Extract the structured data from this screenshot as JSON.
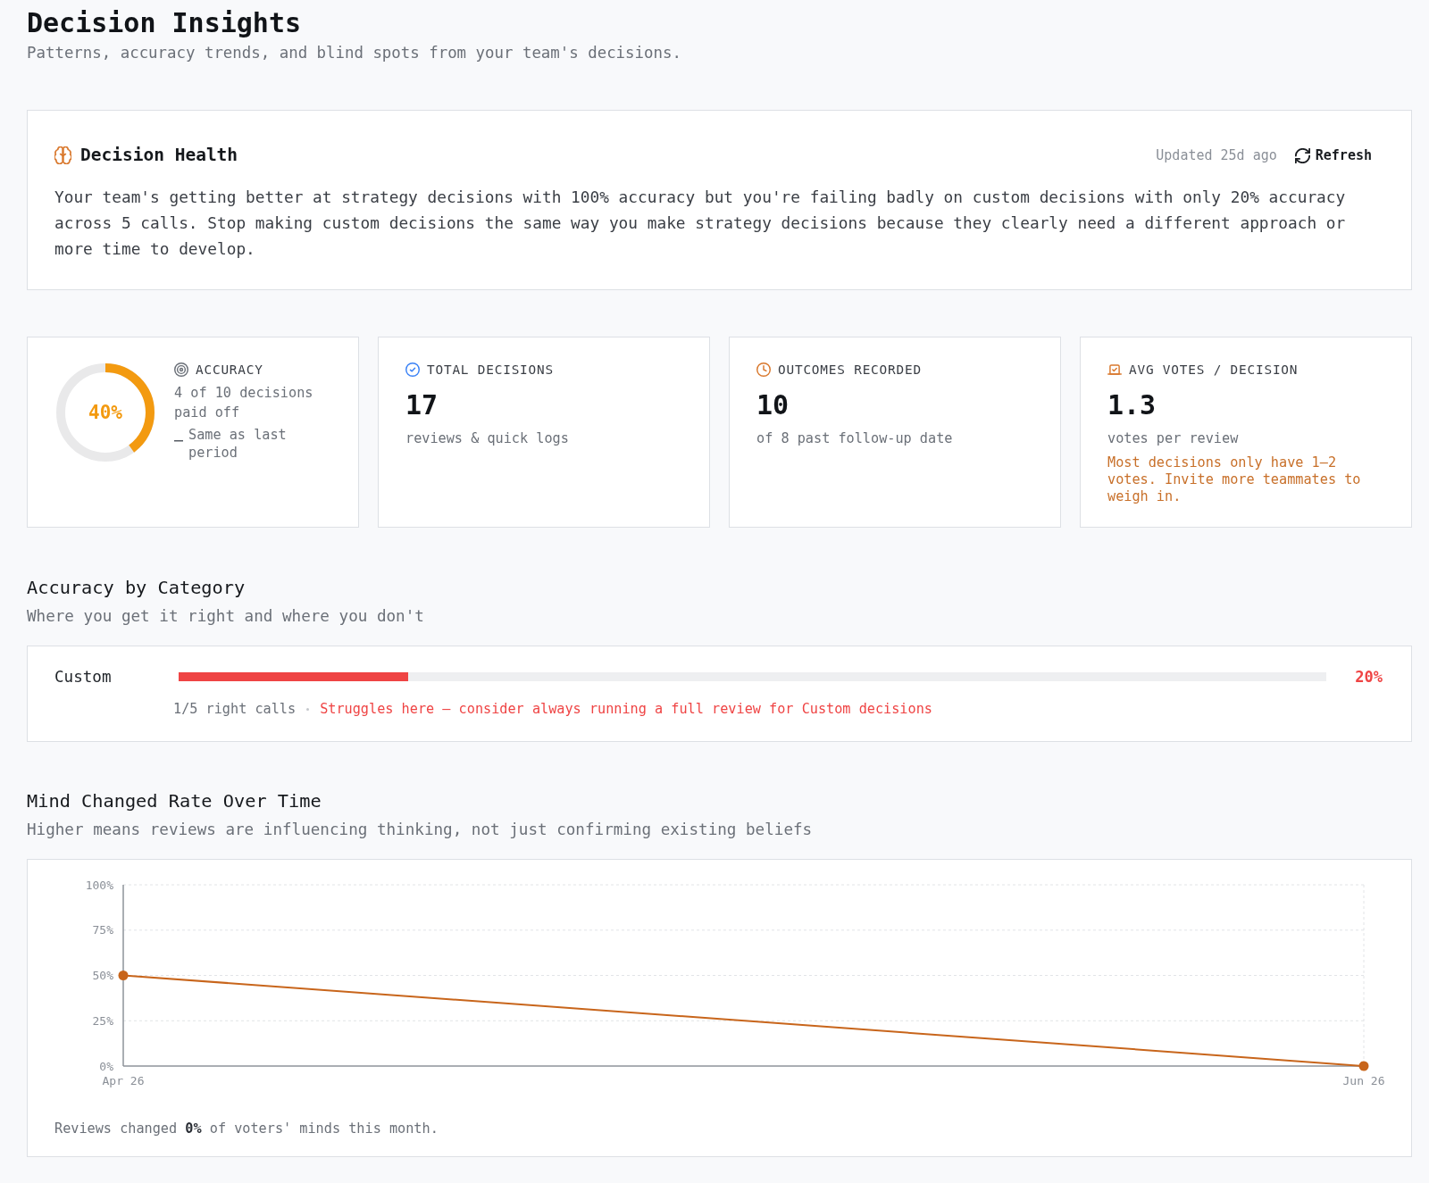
{
  "header": {
    "title": "Decision Insights",
    "subtitle": "Patterns, accuracy trends, and blind spots from your team's decisions."
  },
  "decision_health": {
    "title": "Decision Health",
    "updated": "Updated 25d ago",
    "refresh_button": "Refresh",
    "summary": "Your team's getting better at strategy decisions with 100% accuracy but you're failing badly on custom decisions with only 20% accuracy across 5 calls. Stop making custom decisions the same way you make strategy decisions because they clearly need a different approach or more time to develop."
  },
  "stats": [
    {
      "kind": "donut",
      "label": "ACCURACY",
      "level": 0.4,
      "value": "40%",
      "detail": "4 of 10 decisions paid off",
      "trend": "Same as last period"
    },
    {
      "kind": "metric",
      "label": "TOTAL DECISIONS",
      "value": "17",
      "detail": "reviews & quick logs"
    },
    {
      "kind": "metric",
      "label": "OUTCOMES RECORDED",
      "value": "10",
      "detail": "of 8 past follow-up date"
    },
    {
      "kind": "metric",
      "label": "AVG VOTES / DECISION",
      "value": "1.3",
      "detail": "votes per review",
      "note": "Most decisions only have 1–2 votes. Invite more teammates to weigh in."
    }
  ],
  "accuracy_by_category": {
    "title": "Accuracy by Category",
    "subtitle": "Where you get it right and where you don't",
    "rows": [
      {
        "name": "Custom",
        "level": 0.2,
        "percent": "20%",
        "record": "1/5 right calls",
        "note": "Struggles here — consider always running a full review for Custom decisions"
      }
    ]
  },
  "mind_changed": {
    "title": "Mind Changed Rate Over Time",
    "subtitle": "Higher means reviews are influencing thinking, not just confirming existing beliefs",
    "chart_data": {
      "type": "line",
      "x": [
        "Apr 26",
        "Jun 26"
      ],
      "series": [
        {
          "color": "#c8651b",
          "marker": true,
          "values": [
            50,
            0
          ]
        }
      ],
      "ylim": [
        0,
        100
      ],
      "yticks": [
        {
          "value": 0,
          "label": "0%"
        },
        {
          "value": 25,
          "label": "25%"
        },
        {
          "value": 50,
          "label": "50%"
        },
        {
          "value": 75,
          "label": "75%"
        },
        {
          "value": 100,
          "label": "100%"
        }
      ]
    },
    "summary": "Reviews changed **0%** of voters' minds this month."
  }
}
